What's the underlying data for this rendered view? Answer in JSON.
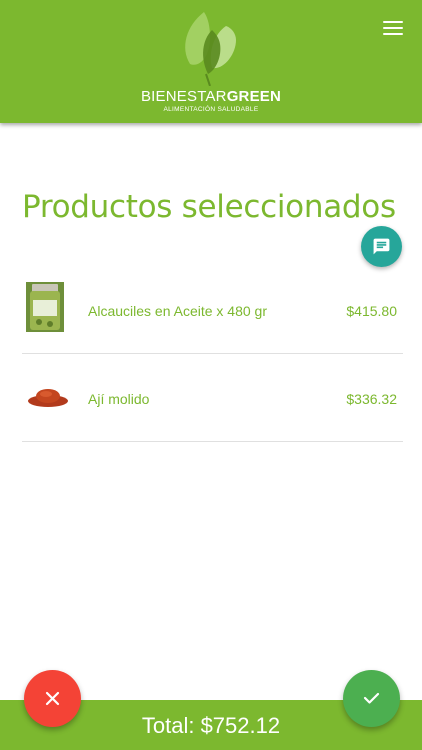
{
  "header": {
    "brand_light": "BIENESTAR",
    "brand_bold": "GREEN",
    "tagline": "ALIMENTACIÓN SALUDABLE",
    "menu_icon": "hamburger-menu-icon"
  },
  "main": {
    "title": "Productos seleccionados",
    "chat_icon": "chat-message-icon",
    "items": [
      {
        "name": "Alcauciles en Aceite x 480 gr",
        "price": "$415.80",
        "image": "jar-product-image"
      },
      {
        "name": "Ají molido",
        "price": "$336.32",
        "image": "ground-chili-image"
      }
    ]
  },
  "footer": {
    "total_label": "Total: $752.12"
  },
  "actions": {
    "cancel_icon": "close-icon",
    "confirm_icon": "check-icon"
  },
  "colors": {
    "brand_green": "#7cb82f",
    "teal": "#26a69a",
    "red": "#f44336",
    "green": "#4caf50"
  }
}
